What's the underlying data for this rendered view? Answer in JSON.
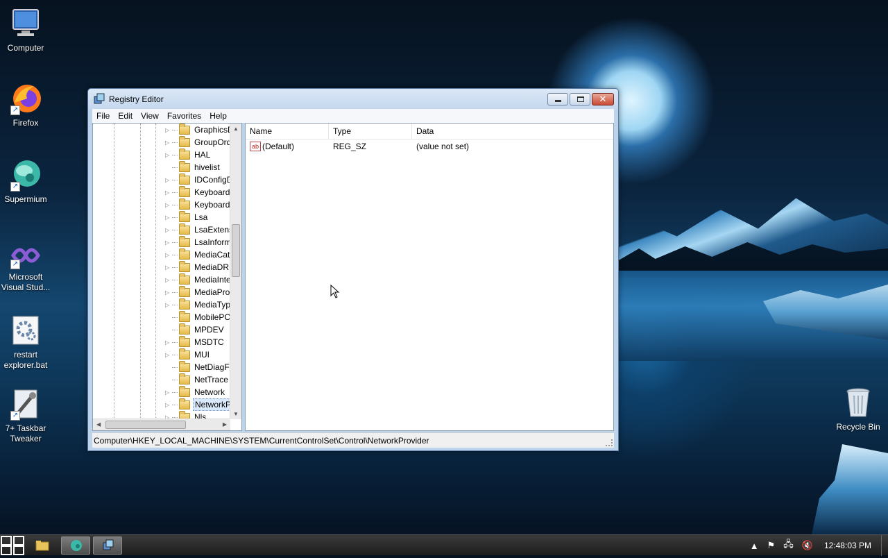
{
  "desktop": {
    "icons": [
      {
        "label": "Computer"
      },
      {
        "label": "Firefox"
      },
      {
        "label": "Supermium"
      },
      {
        "label": "Microsoft Visual Stud..."
      },
      {
        "label": "restart explorer.bat"
      },
      {
        "label": "7+ Taskbar Tweaker"
      },
      {
        "label": "Recycle Bin"
      }
    ]
  },
  "window": {
    "title": "Registry Editor",
    "menu": [
      "File",
      "Edit",
      "View",
      "Favorites",
      "Help"
    ],
    "tree_items": [
      "GraphicsDr",
      "GroupOrde",
      "HAL",
      "hivelist",
      "IDConfigD",
      "Keyboard L",
      "Keyboard L",
      "Lsa",
      "LsaExtensio",
      "LsaInforma",
      "MediaCate",
      "MediaDRM",
      "MediaInter",
      "MediaProp",
      "MediaType",
      "MobilePC",
      "MPDEV",
      "MSDTC",
      "MUI",
      "NetDiagFx",
      "NetTrace",
      "Network",
      "NetworkPr",
      "Nls"
    ],
    "selected_tree_index": 22,
    "columns": {
      "name": "Name",
      "type": "Type",
      "data": "Data"
    },
    "values": [
      {
        "name": "(Default)",
        "type": "REG_SZ",
        "data": "(value not set)",
        "icon": "ab"
      }
    ],
    "status_path": "Computer\\HKEY_LOCAL_MACHINE\\SYSTEM\\CurrentControlSet\\Control\\NetworkProvider"
  },
  "taskbar": {
    "clock": "12:48:03 PM"
  }
}
